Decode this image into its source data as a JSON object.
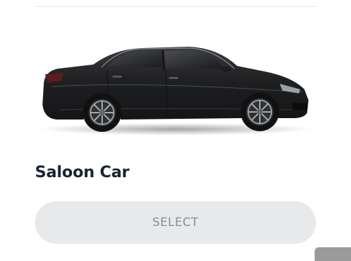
{
  "card": {
    "title": "Saloon Car",
    "select_label": "SELECT",
    "image_subject": "saloon-car"
  },
  "colors": {
    "title": "#1a2433",
    "button_bg": "#e8e9eb",
    "button_text": "#8a8d91",
    "car_body": "#232426"
  }
}
